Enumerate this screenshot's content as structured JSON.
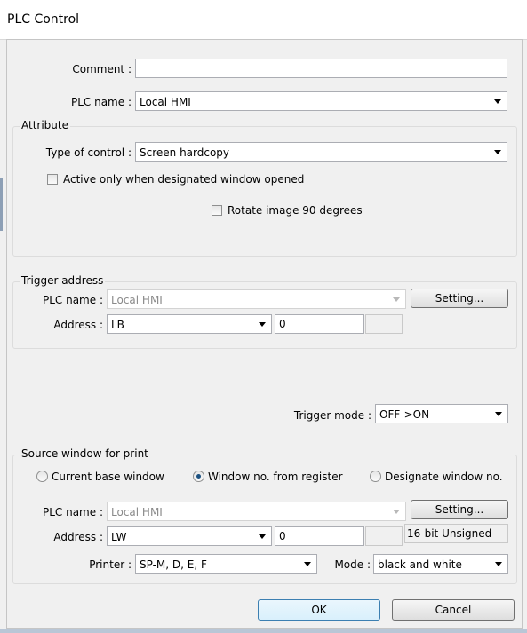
{
  "window": {
    "title": "PLC Control"
  },
  "comment": {
    "label": "Comment :",
    "value": ""
  },
  "plc_name": {
    "label": "PLC name :",
    "value": "Local HMI"
  },
  "attribute": {
    "title": "Attribute",
    "type_label": "Type of control :",
    "type_value": "Screen hardcopy",
    "active_only_label": "Active only when designated window opened",
    "rotate_label": "Rotate image 90 degrees"
  },
  "trigger_address": {
    "title": "Trigger address",
    "plc_label": "PLC name :",
    "plc_value": "Local HMI",
    "setting_label": "Setting...",
    "address_label": "Address :",
    "address_device": "LB",
    "address_value": "0"
  },
  "trigger_mode": {
    "label": "Trigger mode :",
    "value": "OFF->ON"
  },
  "source_window": {
    "title": "Source window for print",
    "radio_current": "Current base window",
    "radio_register": "Window no. from register",
    "radio_designate": "Designate window no.",
    "selected": "Window no. from register",
    "plc_label": "PLC name :",
    "plc_value": "Local HMI",
    "setting_label": "Setting...",
    "address_label": "Address :",
    "address_device": "LW",
    "address_value": "0",
    "data_format": "16-bit Unsigned"
  },
  "printer": {
    "label": "Printer :",
    "value": "SP-M, D, E, F"
  },
  "mode": {
    "label": "Mode :",
    "value": "black and white"
  },
  "buttons": {
    "ok": "OK",
    "cancel": "Cancel"
  }
}
